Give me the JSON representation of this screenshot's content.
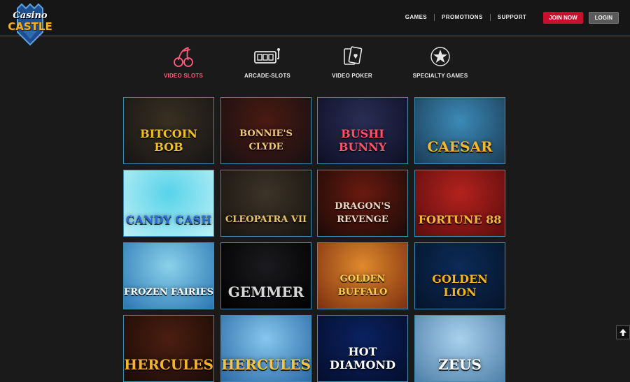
{
  "logo": {
    "line1": "Casino",
    "line2": "CASTLE"
  },
  "nav": {
    "links": [
      "GAMES",
      "PROMOTIONS",
      "SUPPORT"
    ],
    "join_label": "JOIN NOW",
    "login_label": "LOGIN"
  },
  "categories": [
    {
      "label": "VIDEO SLOTS",
      "icon": "cherries-icon",
      "active": true
    },
    {
      "label": "ARCADE-SLOTS",
      "icon": "slot-machine-icon",
      "active": false
    },
    {
      "label": "VIDEO POKER",
      "icon": "playing-cards-icon",
      "active": false
    },
    {
      "label": "SPECIALTY GAMES",
      "icon": "star-icon",
      "active": false
    }
  ],
  "games": [
    {
      "title": "BITCOIN BOB",
      "bg": [
        "#3a2f22",
        "#151515"
      ],
      "color": "#f2c01c"
    },
    {
      "title": "BONNIE'S CLYDE",
      "bg": [
        "#4a1a12",
        "#171012"
      ],
      "color": "#f1c879"
    },
    {
      "title": "BUSHI BUNNY",
      "bg": [
        "#2a2e55",
        "#0e0e25"
      ],
      "color": "#ff5266"
    },
    {
      "title": "CAESAR",
      "bg": [
        "#3c8ab8",
        "#1b3c55"
      ],
      "color": "#f2b830"
    },
    {
      "title": "CANDY CASH",
      "bg": [
        "#57d3e9",
        "#bdeff6"
      ],
      "color": "#2a6be0"
    },
    {
      "title": "CLEOPATRA VII",
      "bg": [
        "#3d3328",
        "#17140f"
      ],
      "color": "#e7c469"
    },
    {
      "title": "DRAGON'S REVENGE",
      "bg": [
        "#6a1a10",
        "#1b0a08"
      ],
      "color": "#e8d7c1"
    },
    {
      "title": "FORTUNE 88",
      "bg": [
        "#b3221e",
        "#5c0d0d"
      ],
      "color": "#f3b73a"
    },
    {
      "title": "FROZEN FAIRIES",
      "bg": [
        "#8ad2ea",
        "#2b76b4"
      ],
      "color": "#ffffff"
    },
    {
      "title": "GEMMER",
      "bg": [
        "#1b1b1f",
        "#000000"
      ],
      "color": "#d7d7d7"
    },
    {
      "title": "GOLDEN BUFFALO",
      "bg": [
        "#e08a2d",
        "#7d2f10"
      ],
      "color": "#f7cf4d"
    },
    {
      "title": "GOLDEN LION",
      "bg": [
        "#0c2b57",
        "#05142a"
      ],
      "color": "#f4b320"
    },
    {
      "title": "HERCULES",
      "bg": [
        "#4b1e10",
        "#1a0b07"
      ],
      "color": "#f2b430"
    },
    {
      "title": "HERCULES",
      "bg": [
        "#86c6ee",
        "#2b6aa5"
      ],
      "color": "#f3c545"
    },
    {
      "title": "HOT DIAMOND",
      "bg": [
        "#0a2260",
        "#050d2c"
      ],
      "color": "#ffffff"
    },
    {
      "title": "ZEUS",
      "bg": [
        "#a9d1ec",
        "#4e7fa9"
      ],
      "color": "#ffffff"
    }
  ],
  "back_to_top": "back-to-top-arrow"
}
